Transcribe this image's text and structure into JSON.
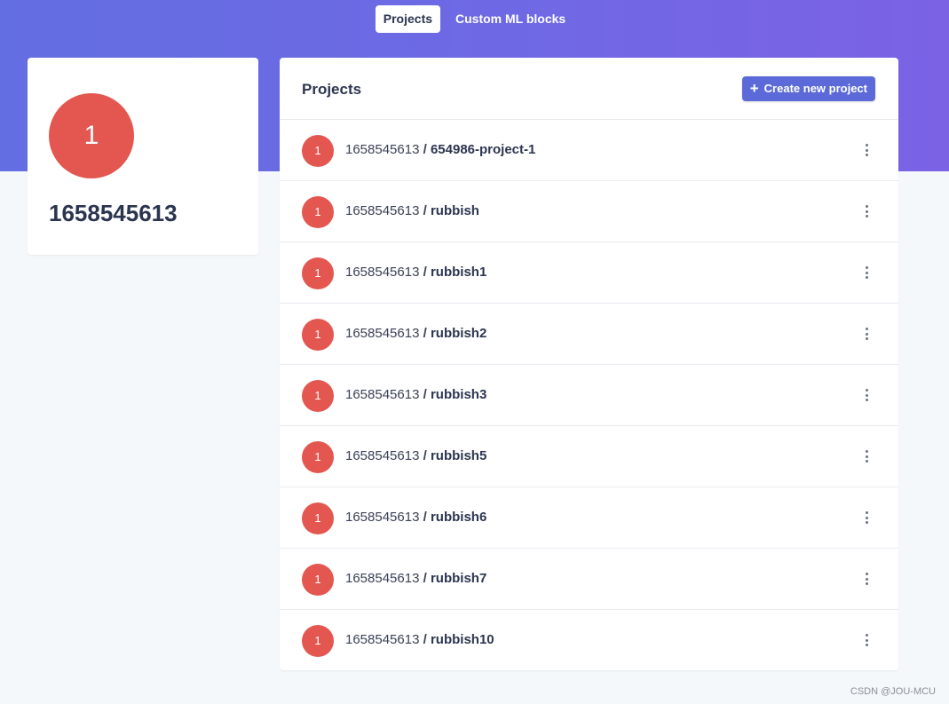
{
  "topnav": {
    "tabs": [
      {
        "label": "Projects",
        "active": true
      },
      {
        "label": "Custom ML blocks",
        "active": false
      }
    ]
  },
  "profile": {
    "avatar_initial": "1",
    "username": "1658545613"
  },
  "projects": {
    "title": "Projects",
    "create_button_label": "Create new project",
    "separator": " / ",
    "items": [
      {
        "avatar": "1",
        "owner": "1658545613",
        "name": "654986-project-1"
      },
      {
        "avatar": "1",
        "owner": "1658545613",
        "name": "rubbish"
      },
      {
        "avatar": "1",
        "owner": "1658545613",
        "name": "rubbish1"
      },
      {
        "avatar": "1",
        "owner": "1658545613",
        "name": "rubbish2"
      },
      {
        "avatar": "1",
        "owner": "1658545613",
        "name": "rubbish3"
      },
      {
        "avatar": "1",
        "owner": "1658545613",
        "name": "rubbish5"
      },
      {
        "avatar": "1",
        "owner": "1658545613",
        "name": "rubbish6"
      },
      {
        "avatar": "1",
        "owner": "1658545613",
        "name": "rubbish7"
      },
      {
        "avatar": "1",
        "owner": "1658545613",
        "name": "rubbish10"
      }
    ]
  },
  "watermark": "CSDN @JOU-MCU",
  "colors": {
    "hero_gradient_start": "#636ee2",
    "hero_gradient_end": "#7b62e4",
    "avatar": "#e35750",
    "primary_button": "#5b6ad8",
    "page_background": "#f5f8fa"
  },
  "icons": {
    "create_button": "plus-icon",
    "row_menu": "kebab-menu-icon"
  }
}
